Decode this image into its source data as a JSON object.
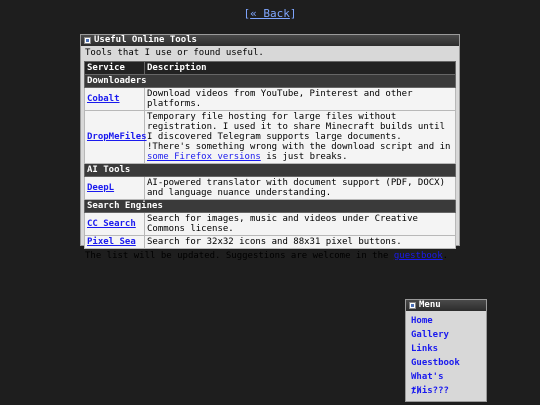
{
  "back_link": "« Back",
  "tools_window": {
    "title": "Useful Online Tools",
    "intro": "Tools that I use or found useful.",
    "headers": {
      "service": "Service",
      "description": "Description"
    },
    "categories": [
      {
        "name": "Downloaders",
        "rows": [
          {
            "service": "Cobalt",
            "description": "Download videos from YouTube, Pinterest and other platforms."
          },
          {
            "service": "DropMeFiles",
            "description": "Temporary file hosting for large files without registration. I used it to share Minecraft builds until I discovered Telegram supports large documents.",
            "note_before": "!There's something wrong with the download script and in ",
            "note_link": "some Firefox versions",
            "note_after": " is just breaks."
          }
        ]
      },
      {
        "name": "AI Tools",
        "rows": [
          {
            "service": "DeepL",
            "description": "AI-powered translator with document support (PDF, DOCX) and language nuance understanding."
          }
        ]
      },
      {
        "name": "Search Engines",
        "rows": [
          {
            "service": "CC Search",
            "description": "Search for images, music and videos under Creative Commons license."
          },
          {
            "service": "Pixel Sea",
            "description": "Search for 32x32 icons and 88x31 pixel buttons."
          }
        ]
      }
    ],
    "footer_before": "The list will be updated. Suggestions are welcome in the ",
    "footer_link": "guestbook",
    "footer_after": "."
  },
  "menu_window": {
    "title": "Menu",
    "items": [
      "Home",
      "Gallery",
      "Links",
      "Guestbook",
      "What's this???",
      "//"
    ]
  }
}
